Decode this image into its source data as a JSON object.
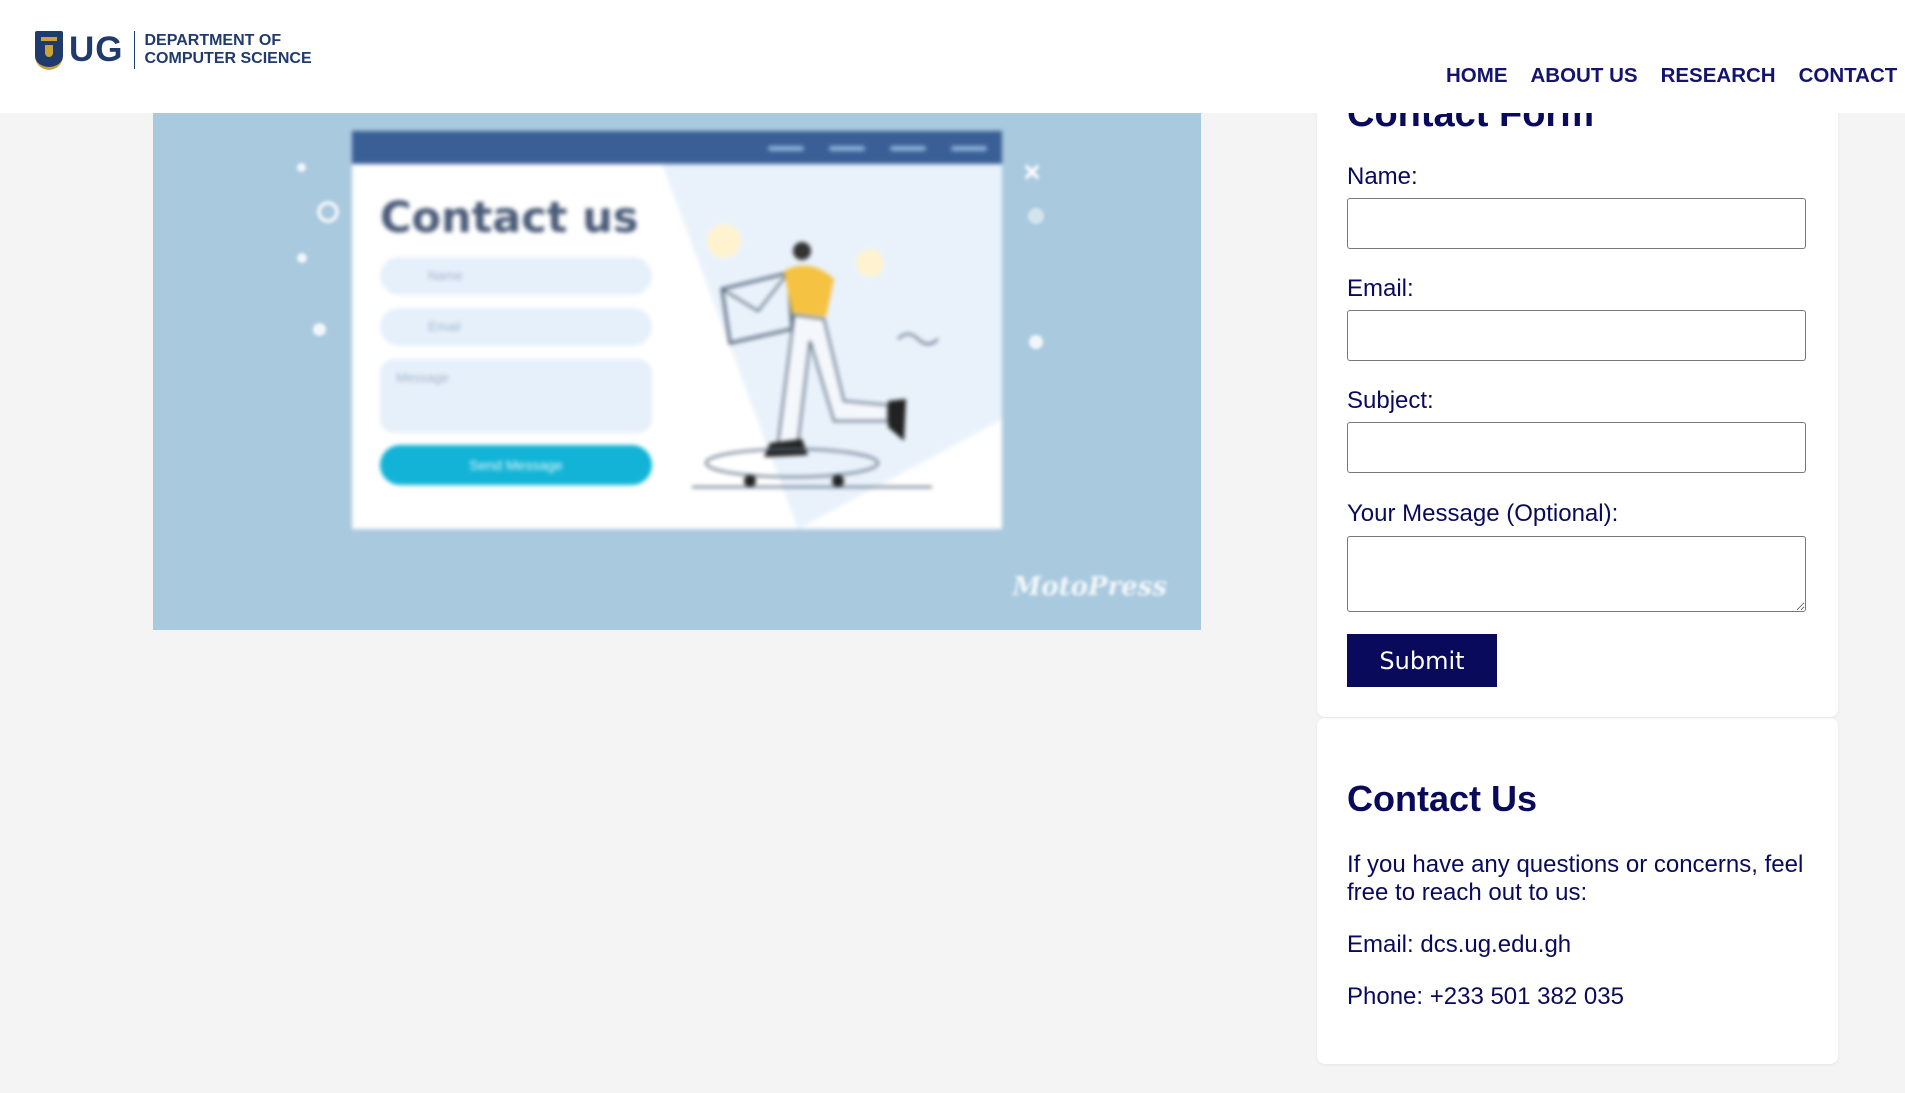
{
  "header": {
    "logo_short": "UG",
    "logo_line1": "DEPARTMENT OF",
    "logo_line2": "COMPUTER SCIENCE",
    "nav": [
      "HOME",
      "ABOUT US",
      "RESEARCH",
      "CONTACT"
    ]
  },
  "hero": {
    "mock_title": "Contact us",
    "mock_fields": [
      "Name",
      "Email",
      "Message"
    ],
    "mock_button": "Send Message",
    "brand": "MotoPress"
  },
  "form": {
    "title": "Contact Form",
    "name_label": "Name:",
    "email_label": "Email:",
    "subject_label": "Subject:",
    "message_label": "Your Message (Optional):",
    "submit_label": "Submit"
  },
  "contact": {
    "title": "Contact Us",
    "intro": "If you have any questions or concerns, feel free to reach out to us:",
    "email": "Email: dcs.ug.edu.gh",
    "phone": "Phone: +233 501 382 035"
  },
  "colors": {
    "brand_navy": "#0a0a5c",
    "hero_bg": "#a9c9de",
    "page_bg": "#f4f4f4"
  }
}
